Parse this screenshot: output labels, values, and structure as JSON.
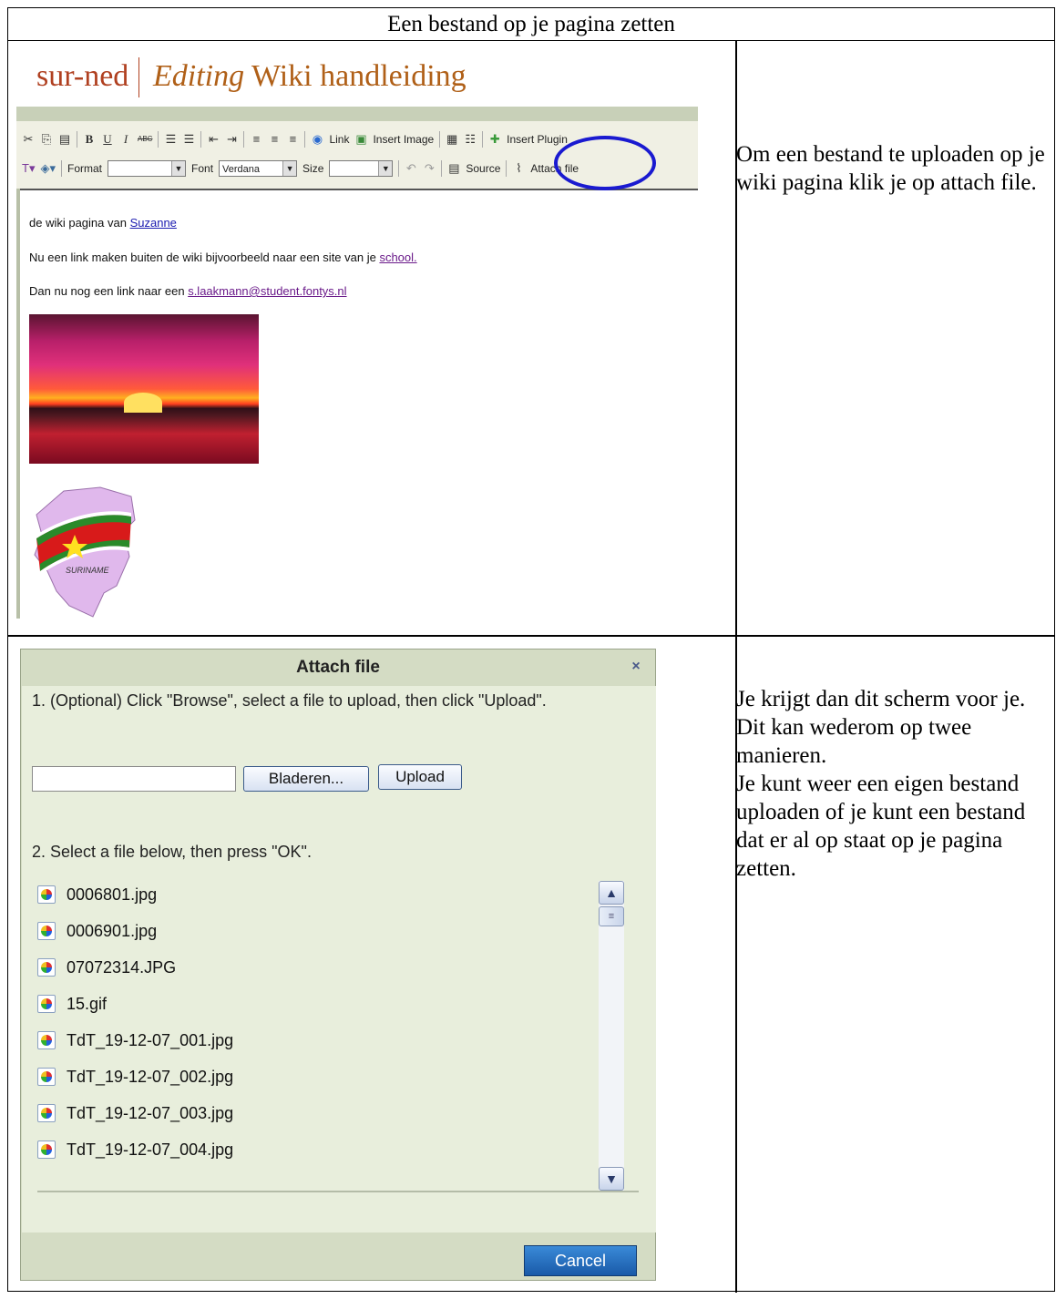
{
  "doc": {
    "header": "Een bestand op je pagina zetten",
    "caption1": "Om een bestand te uploaden op je wiki pagina klik je op attach file.",
    "caption2_lines": [
      "Je krijgt dan dit scherm voor je.",
      "Dit kan wederom op twee manieren.",
      "Je kunt weer een eigen bestand uploaden of je kunt een bestand dat er al op staat op je pagina zetten."
    ]
  },
  "editor": {
    "site": "sur-ned",
    "editing": "Editing",
    "page": "Wiki handleiding",
    "toolbar": {
      "bold": "B",
      "underline": "U",
      "italic": "I",
      "strike": "ABC",
      "link": "Link",
      "insert_image": "Insert Image",
      "insert_plugin": "Insert Plugin",
      "format": "Format",
      "font": "Font",
      "font_value": "Verdana",
      "size": "Size",
      "source": "Source",
      "attach_file": "Attach file"
    },
    "line1_text": "de wiki pagina van ",
    "line1_link": "Suzanne",
    "line2_text": "Nu een link maken buiten de wiki bijvoorbeeld naar een site van je ",
    "line2_link": "school.",
    "line3_text": "Dan nu nog een link naar een  ",
    "line3_link": "s.laakmann@student.fontys.nl",
    "flag_text": "SURINAME"
  },
  "dialog": {
    "title": "Attach file",
    "close": "×",
    "step1": "1. (Optional) Click \"Browse\", select a file to upload, then click \"Upload\".",
    "browse": "Bladeren...",
    "upload": "Upload",
    "step2": "2. Select a file below, then press \"OK\".",
    "files": [
      "0006801.jpg",
      "0006901.jpg",
      "07072314.JPG",
      "15.gif",
      "TdT_19-12-07_001.jpg",
      "TdT_19-12-07_002.jpg",
      "TdT_19-12-07_003.jpg",
      "TdT_19-12-07_004.jpg"
    ],
    "cancel": "Cancel"
  }
}
